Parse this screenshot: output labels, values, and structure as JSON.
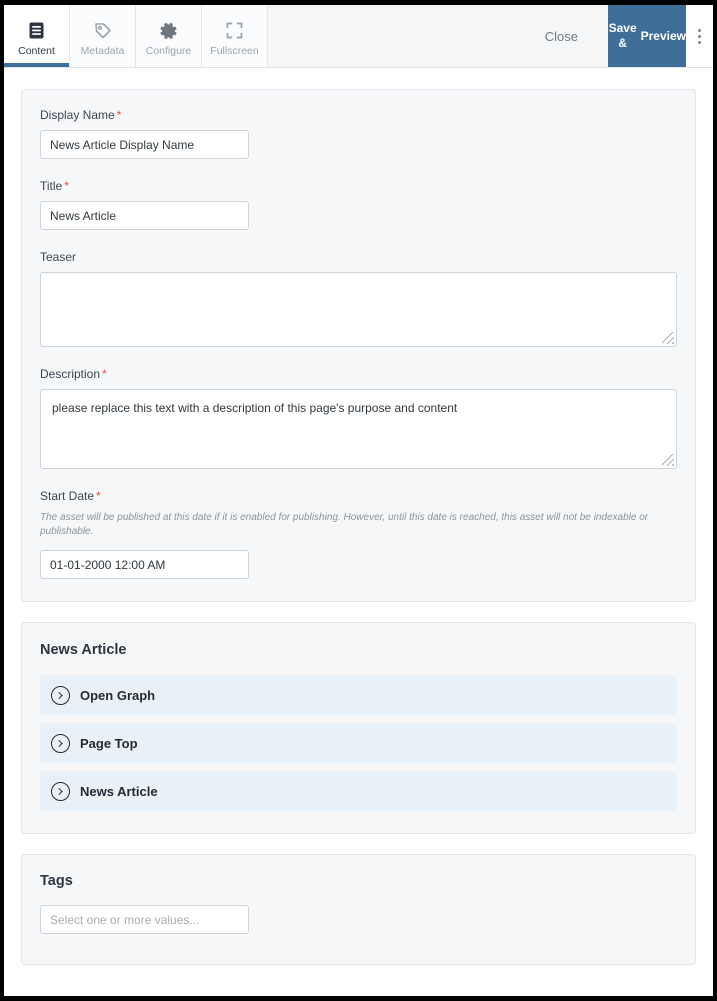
{
  "toolbar": {
    "tabs": [
      {
        "label": "Content",
        "icon": "content-document-icon",
        "active": true
      },
      {
        "label": "Metadata",
        "icon": "tag-icon",
        "active": false
      },
      {
        "label": "Configure",
        "icon": "gear-icon",
        "active": false
      },
      {
        "label": "Fullscreen",
        "icon": "fullscreen-expand-icon",
        "active": false
      }
    ],
    "close_label": "Close",
    "save_label": "Save & Preview",
    "save_line1": "Save &",
    "save_line2": "Preview",
    "overflow_icon": "kebab-menu-icon",
    "accent_color": "#3f6f99"
  },
  "content_form": {
    "display_name": {
      "label": "Display Name",
      "required": true,
      "value": "News Article Display Name"
    },
    "title": {
      "label": "Title",
      "required": true,
      "value": "News Article"
    },
    "teaser": {
      "label": "Teaser",
      "required": false,
      "value": ""
    },
    "description": {
      "label": "Description",
      "required": true,
      "value": "please replace this text with a description of this page's purpose and content"
    },
    "start_date": {
      "label": "Start Date",
      "required": true,
      "help": "The asset will be published at this date if it is enabled for publishing. However, until this date is reached, this asset will not be indexable or publishable.",
      "value": "01-01-2000 12:00 AM"
    },
    "required_marker": "*"
  },
  "news_article_section": {
    "title": "News Article",
    "rows": [
      {
        "label": "Open Graph",
        "icon": "chevron-right-circle-icon"
      },
      {
        "label": "Page Top",
        "icon": "chevron-right-circle-icon"
      },
      {
        "label": "News Article",
        "icon": "chevron-right-circle-icon"
      }
    ]
  },
  "tags_section": {
    "title": "Tags",
    "input_placeholder": "Select one or more values..."
  }
}
